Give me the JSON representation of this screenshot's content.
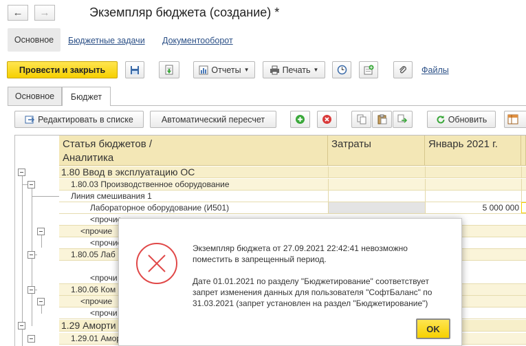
{
  "window": {
    "title": "Экземпляр бюджета (создание) *"
  },
  "nav": {
    "back": "←",
    "forward": "→"
  },
  "subnav": {
    "main": "Основное",
    "tasks": "Бюджетные задачи",
    "docflow": "Документооборот"
  },
  "toolbar": {
    "post_close": "Провести и закрыть",
    "reports": "Отчеты",
    "print": "Печать",
    "files": "Файлы"
  },
  "tabs": [
    "Основное",
    "Бюджет"
  ],
  "budget_toolbar": {
    "edit_list": "Редактировать в списке",
    "auto_recalc": "Автоматический пересчет",
    "refresh": "Обновить"
  },
  "table": {
    "headers": {
      "article": "Статья бюджетов /",
      "article2": "Аналитика",
      "costs": "Затраты",
      "january": "Январь 2021 г."
    },
    "rows": [
      {
        "label": "1.80 Ввод в эксплуатацию ОС",
        "value": ""
      },
      {
        "label": "1.80.03 Производственное оборудование",
        "value": ""
      },
      {
        "label": "Линия смешивания 1",
        "value": ""
      },
      {
        "label": "Лабораторное оборудование (И501)",
        "value": "5 000 000"
      },
      {
        "label": "<прочие",
        "value": ""
      },
      {
        "label": "<прочие",
        "value": ""
      },
      {
        "label": "<прочие",
        "value": ""
      },
      {
        "label": "1.80.05 Лаб",
        "value": ""
      },
      {
        "label": "<прочи",
        "value": ""
      },
      {
        "label": "1.80.06 Ком",
        "value": ""
      },
      {
        "label": "<прочие",
        "value": ""
      },
      {
        "label": "<прочи",
        "value": ""
      },
      {
        "label": "1.29 Аморти",
        "value": ""
      },
      {
        "label": "1.29.01 Амор",
        "value": ""
      }
    ]
  },
  "modal": {
    "line1": "Экземпляр бюджета  от 27.09.2021 22:42:41 невозможно",
    "line2": "поместить в запрещенный период.",
    "line3": "Дате 01.01.2021 по разделу \"Бюджетирование\" соответствует",
    "line4": "запрет изменения данных для пользователя \"СофтБаланс\" по",
    "line5": "31.03.2021 (запрет установлен на раздел \"Бюджетирование\")",
    "ok": "OK"
  },
  "colors": {
    "accent_yellow": "#f6d000",
    "header_bg": "#f3e7b6",
    "error_red": "#e04848",
    "add_green": "#3aa83a"
  }
}
